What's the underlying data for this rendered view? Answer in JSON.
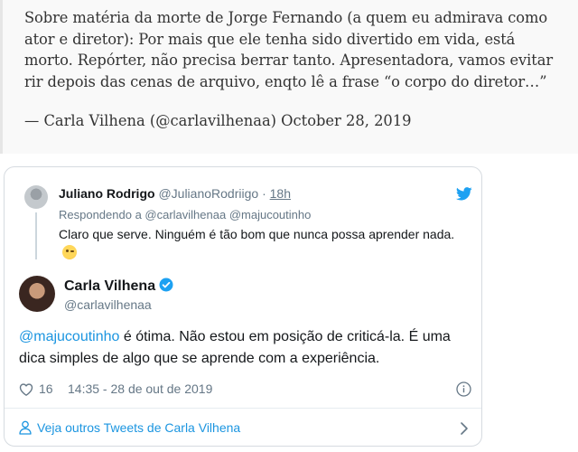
{
  "quote": {
    "text": "Sobre matéria da morte de Jorge Fernando (a quem eu admirava como ator e diretor): Por mais que ele tenha sido divertido em vida, está morto. Repórter, não precisa berrar tanto. Apresentadora, vamos evitar rir depois das cenas de arquivo, enqto lê a frase “o corpo do diretor…”",
    "attribution": "— Carla Vilhena (@carlavilhenaa) October 28, 2019"
  },
  "reply": {
    "name": "Juliano Rodrigo",
    "handle": "@JulianoRodriigo",
    "separator": "·",
    "time": "18h",
    "replying_to": "Respondendo a @carlavilhenaa @majucoutinho",
    "text": "Claro que serve. Ninguém é tão bom que nunca possa aprender nada.",
    "emoji": "winking-face"
  },
  "tweet": {
    "name": "Carla Vilhena",
    "handle": "@carlavilhenaa",
    "mention": "@majucoutinho",
    "text_rest": " é ótima. Não estou em posição de criticá-la. É uma dica simples de algo que se aprende com a experiência.",
    "likes": "16",
    "timestamp": "14:35 - 28 de out de 2019",
    "more_tweets": "Veja outros Tweets de Carla Vilhena"
  },
  "icons": {
    "bird": "twitter-bird-icon",
    "verified": "verified-badge-icon",
    "heart": "heart-icon",
    "info": "info-icon",
    "person": "person-icon",
    "chevron": "chevron-right-icon"
  },
  "colors": {
    "brand_blue": "#1da1f2",
    "link_blue": "#1b95e0",
    "muted_gray": "#657786",
    "border": "#d6dbe0"
  }
}
